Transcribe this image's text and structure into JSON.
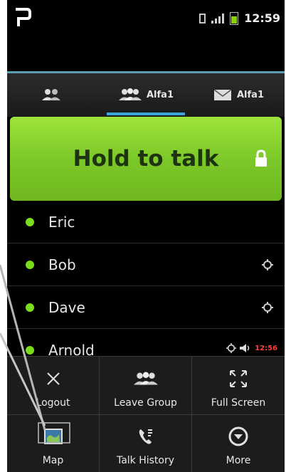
{
  "status": {
    "time": "12:59"
  },
  "tabs": [
    {
      "label": "",
      "icon": "group-icon"
    },
    {
      "label": "Alfa1",
      "icon": "group-icon"
    },
    {
      "label": "Alfa1",
      "icon": "mail-icon"
    }
  ],
  "ptt": {
    "label": "Hold to talk",
    "icon": "lock-icon"
  },
  "members": [
    {
      "name": "Eric"
    },
    {
      "name": "Bob"
    },
    {
      "name": "Dave"
    },
    {
      "name": "Arnold",
      "status": "12:56"
    }
  ],
  "menu": [
    {
      "label": "Logout",
      "icon": "close-icon"
    },
    {
      "label": "Leave Group",
      "icon": "group-icon"
    },
    {
      "label": "Full Screen",
      "icon": "fullscreen-icon"
    },
    {
      "label": "Map",
      "icon": "map-icon"
    },
    {
      "label": "Talk History",
      "icon": "call-history-icon"
    },
    {
      "label": "More",
      "icon": "more-icon"
    }
  ],
  "colors": {
    "accent": "#3da5d9",
    "ptt": "#8ad12c",
    "online": "#7bdc1e"
  }
}
